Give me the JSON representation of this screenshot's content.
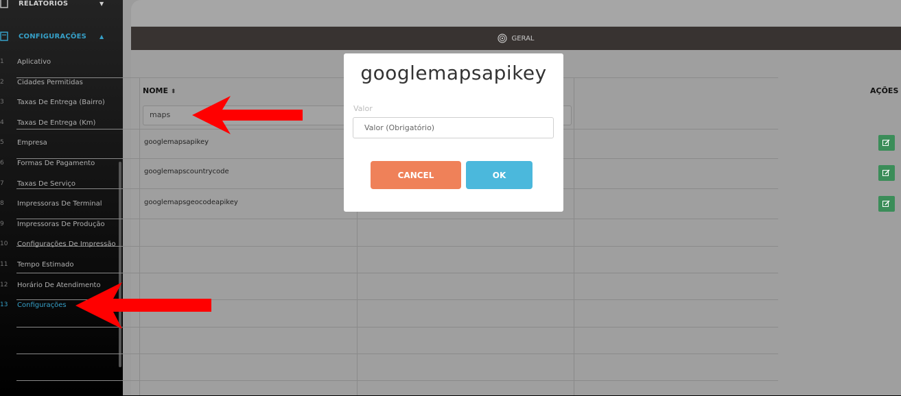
{
  "sidebar": {
    "relatorios_label": "RELATÓRIOS",
    "configuracoes_label": "CONFIGURAÇÕES",
    "items": [
      {
        "num": "1",
        "label": "Aplicativo"
      },
      {
        "num": "2",
        "label": "Cidades Permitidas"
      },
      {
        "num": "3",
        "label": "Taxas De Entrega (Bairro)"
      },
      {
        "num": "4",
        "label": "Taxas De Entrega (Km)"
      },
      {
        "num": "5",
        "label": "Empresa"
      },
      {
        "num": "6",
        "label": "Formas De Pagamento"
      },
      {
        "num": "7",
        "label": "Taxas De Serviço"
      },
      {
        "num": "8",
        "label": "Impressoras De Terminal"
      },
      {
        "num": "9",
        "label": "Impressoras De Produção"
      },
      {
        "num": "10",
        "label": "Configurações De Impressão"
      },
      {
        "num": "11",
        "label": "Tempo Estimado"
      },
      {
        "num": "12",
        "label": "Horário De Atendimento"
      },
      {
        "num": "13",
        "label": "Configurações"
      }
    ],
    "active_item": "Configurações"
  },
  "header": {
    "section_label": "GERAL"
  },
  "table": {
    "col_nome": "NOME",
    "col_acoes": "AÇÕES",
    "filter_value": "maps",
    "rows": [
      {
        "nome": "googlemapsapikey"
      },
      {
        "nome": "googlemapscountrycode"
      },
      {
        "nome": "googlemapsgeocodeapikey"
      }
    ]
  },
  "modal": {
    "title": "googlemapsapikey",
    "field_label": "Valor",
    "field_placeholder": "Valor (Obrigatório)",
    "cancel_label": "CANCEL",
    "ok_label": "OK"
  },
  "colors": {
    "accent": "#36a0c8",
    "cancel": "#ef8159",
    "ok": "#4bb8dc",
    "edit": "#3b8d59",
    "arrow": "#ff0000"
  }
}
